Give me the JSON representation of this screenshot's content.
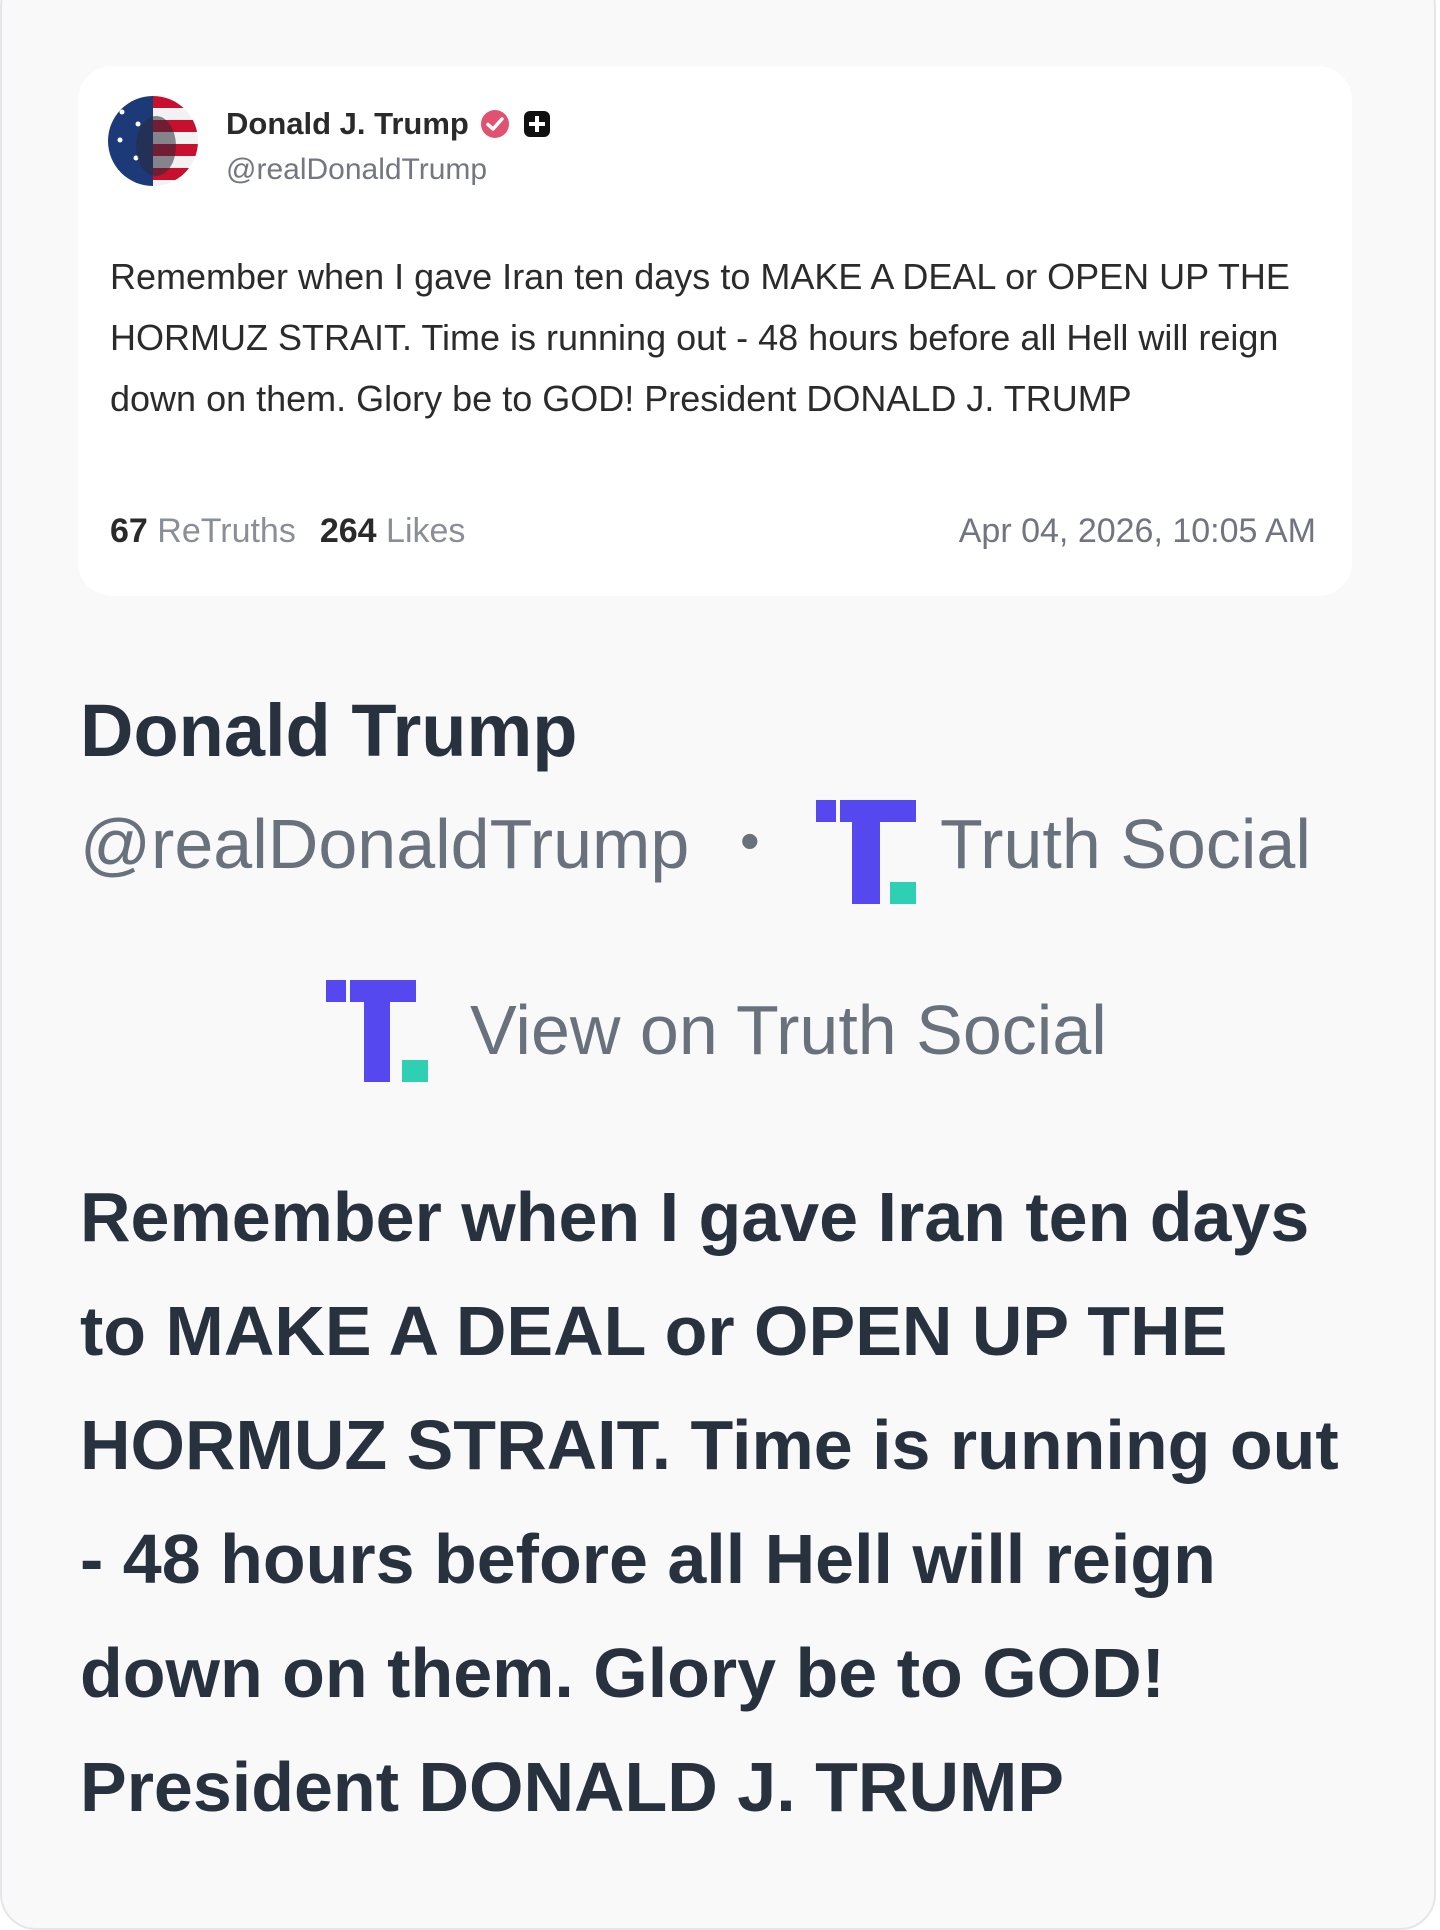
{
  "post": {
    "author_name": "Donald J. Trump",
    "author_handle": "@realDonaldTrump",
    "text": "Remember when I gave Iran ten days to MAKE A DEAL or OPEN UP THE HORMUZ STRAIT. Time is running out - 48 hours before all Hell will reign down on them. Glory be to GOD! President DONALD J. TRUMP",
    "retruths_count": "67",
    "retruths_label": "ReTruths",
    "likes_count": "264",
    "likes_label": "Likes",
    "timestamp": "Apr 04, 2026, 10:05 AM",
    "icons": {
      "verified": "verified-badge-icon",
      "plus": "plus-square-icon"
    },
    "colors": {
      "verified": "#e0526f"
    }
  },
  "embed": {
    "title": "Donald Trump",
    "handle": "@realDonaldTrump",
    "separator": "•",
    "platform": "Truth Social",
    "view_link": "View on Truth Social",
    "body": "Remember when I gave Iran ten days to MAKE A DEAL or OPEN UP THE HORMUZ STRAIT. Time is running out - 48 hours before all Hell will reign down on them. Glory be to GOD! President DONALD J. TRUMP"
  },
  "brand_colors": {
    "truth_purple": "#5448ee",
    "truth_teal": "#2ecfb3"
  }
}
